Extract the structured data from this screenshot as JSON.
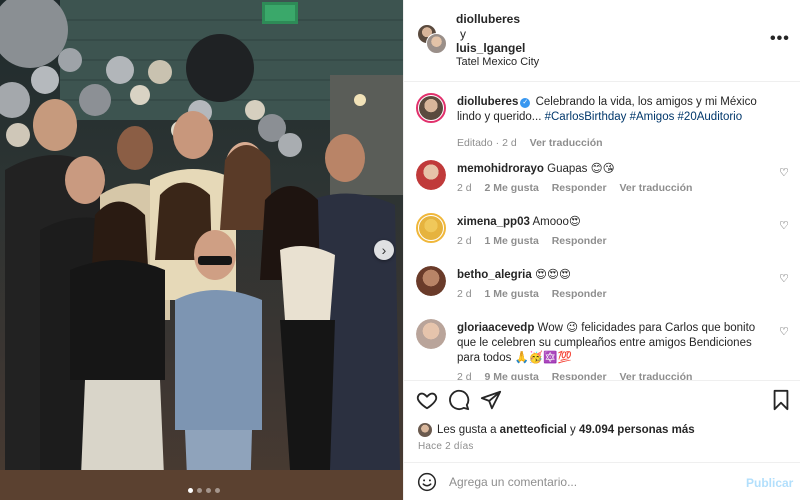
{
  "post_photo": {
    "carousel_dots": 4,
    "active_dot": 1
  },
  "header": {
    "user1": "diolluberes",
    "conjunction": "y",
    "user2": "luis_lgangel",
    "location": "Tatel Mexico City"
  },
  "caption": {
    "username": "diolluberes",
    "text": "Celebrando la vida, los amigos y mi México lindo y querido...",
    "hashtags": "#CarlosBirthday #Amigos #20Auditorio",
    "status": "Editado",
    "age": "2 d",
    "translate": "Ver traducción"
  },
  "comments": [
    {
      "username": "memohidrorayo",
      "text": "Guapas 😊😘",
      "age": "2 d",
      "likes": "2 Me gusta",
      "reply": "Responder",
      "translate": "Ver traducción"
    },
    {
      "username": "ximena_pp03",
      "text": "Amooo😍",
      "age": "2 d",
      "likes": "1 Me gusta",
      "reply": "Responder"
    },
    {
      "username": "betho_alegria",
      "text": "😍😍😍",
      "age": "2 d",
      "likes": "1 Me gusta",
      "reply": "Responder"
    },
    {
      "username": "gloriaacevedp",
      "text": "Wow 😉 felicidades para Carlos que bonito que le celebren su cumpleaños entre amigos Bendiciones para todos 🙏🥳🔯💯",
      "age": "2 d",
      "likes": "9 Me gusta",
      "reply": "Responder",
      "translate": "Ver traducción"
    }
  ],
  "likes": {
    "prefix": "Les gusta a",
    "user": "anetteoficial",
    "middle": "y",
    "count": "49.094 personas más"
  },
  "posted_ago": "Hace 2 días",
  "add_comment": {
    "placeholder": "Agrega un comentario...",
    "publish": "Publicar"
  },
  "icons": {
    "more": "more-options-icon",
    "like": "heart-icon",
    "comment": "comment-icon",
    "share": "send-icon",
    "save": "bookmark-icon",
    "emoji": "emoji-icon",
    "next": "chevron-right-icon"
  },
  "colors": {
    "link": "#00376b",
    "muted": "#8e8e8e",
    "verified": "#3897f0",
    "publish": "#b2dffc",
    "story_ring": "#e1306c"
  }
}
